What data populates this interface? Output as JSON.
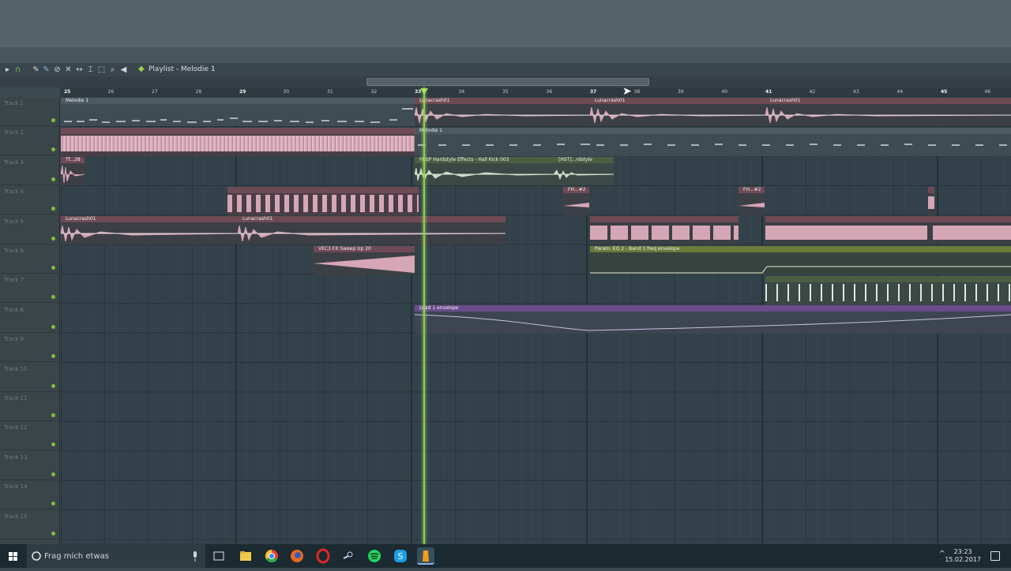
{
  "window": {
    "playlist_title": "Playlist - Melodie 1",
    "playlist_arrow": "◆",
    "playlist_chevron": "›"
  },
  "ruler": {
    "bars": [
      "25",
      "26",
      "27",
      "28",
      "29",
      "30",
      "31",
      "32",
      "33",
      "34",
      "35",
      "36",
      "37",
      "38",
      "39",
      "40",
      "41",
      "42",
      "43",
      "44",
      "45",
      "46"
    ],
    "bold_bars": [
      "25",
      "29",
      "33",
      "37",
      "41",
      "45"
    ]
  },
  "tracks": [
    {
      "label": "Track 1"
    },
    {
      "label": "Track 2"
    },
    {
      "label": "Track 3"
    },
    {
      "label": "Track 4"
    },
    {
      "label": "Track 5"
    },
    {
      "label": "Track 6"
    },
    {
      "label": "Track 7"
    },
    {
      "label": "Track 8"
    },
    {
      "label": "Track 9"
    },
    {
      "label": "Track 10"
    },
    {
      "label": "Track 11"
    },
    {
      "label": "Track 12"
    },
    {
      "label": "Track 13"
    },
    {
      "label": "Track 14"
    },
    {
      "label": "Track 15"
    }
  ],
  "clips": {
    "t1_melodie": "Melodie 1",
    "t1_luna_a": "Lunacrash01",
    "t1_luna_b": "Lunacrash01",
    "t1_luna_c": "Lunacrash01",
    "t2_melodie": "Melodie 1",
    "t3_tf": "Tf...28",
    "t3_fhsp": "FHSP Hardstyle Effects - Hall Kick 003",
    "t3_hst": "[HST]...rdstyle",
    "t4_fh_a": "FH...#2",
    "t4_fh_b": "FH...#2",
    "t5_luna_a": "Lunacrash01",
    "t5_luna_b": "Lunacrash01",
    "t6_vec": "VEC3 FX Sweep Up 20",
    "t6_param": "Param. EQ 2 - Band 1 freq envelope",
    "t8_env": "Lead 1 envelope"
  },
  "taskbar": {
    "search_placeholder": "Frag mich etwas",
    "time": "23:23",
    "date": "15.02.2017"
  },
  "colors": {
    "clip_pink": "#d5a6b6",
    "clip_head_pink": "#6e4a55",
    "clip_green_head": "#4a5e43",
    "clip_olive": "#6a7a3a",
    "clip_purple": "#6a4c8c",
    "playhead": "#8cd04a"
  }
}
